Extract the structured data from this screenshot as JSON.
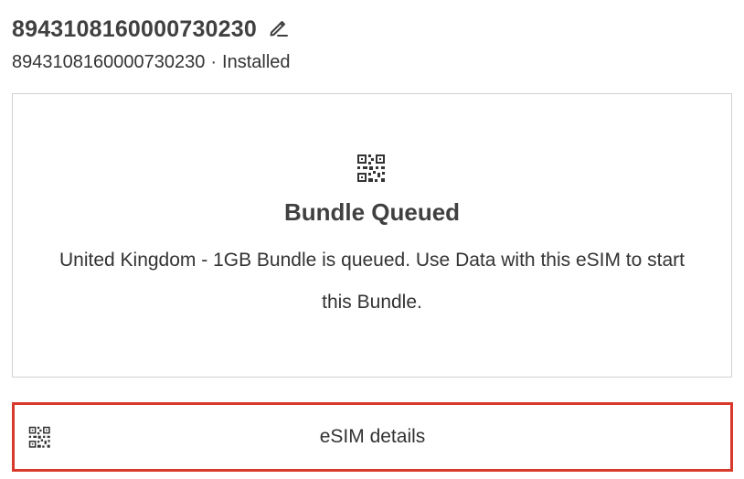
{
  "esim": {
    "title": "8943108160000730230",
    "iccid": "8943108160000730230",
    "separator": "·",
    "status": "Installed"
  },
  "icons": {
    "edit": "pencil-icon",
    "qr": "qr-code-icon"
  },
  "bundle_card": {
    "title": "Bundle Queued",
    "description": "United Kingdom - 1GB Bundle is queued. Use Data with this eSIM to start this Bundle."
  },
  "details_button": {
    "label": "eSIM details",
    "highlight_color": "#d8392b"
  },
  "colors": {
    "text": "#333333",
    "heading": "#404040",
    "border": "#d0d0d0"
  }
}
